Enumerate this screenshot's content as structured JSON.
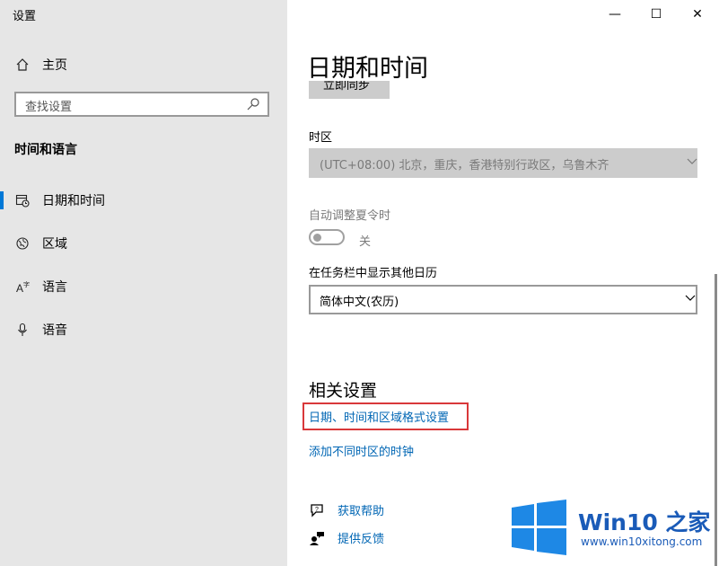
{
  "window": {
    "title": "设置",
    "minimize": "—",
    "maximize": "☐",
    "close": "✕"
  },
  "sidebar": {
    "home_label": "主页",
    "search_placeholder": "查找设置",
    "section_title": "时间和语言",
    "items": [
      {
        "label": "日期和时间",
        "icon": "calendar-clock-icon",
        "active": true
      },
      {
        "label": "区域",
        "icon": "globe-icon",
        "active": false
      },
      {
        "label": "语言",
        "icon": "language-icon",
        "active": false
      },
      {
        "label": "语音",
        "icon": "microphone-icon",
        "active": false
      }
    ]
  },
  "main": {
    "title": "日期和时间",
    "sync_button": "立即同步",
    "timezone_label": "时区",
    "timezone_value": "(UTC+08:00) 北京，重庆，香港特别行政区，乌鲁木齐",
    "dst_label": "自动调整夏令时",
    "dst_state": "关",
    "calendar_label": "在任务栏中显示其他日历",
    "calendar_value": "简体中文(农历)",
    "related_title": "相关设置",
    "related_links": [
      "日期、时间和区域格式设置",
      "添加不同时区的时钟"
    ],
    "help_links": [
      {
        "label": "获取帮助",
        "icon": "help-chat-icon"
      },
      {
        "label": "提供反馈",
        "icon": "feedback-icon"
      }
    ]
  },
  "watermark": {
    "brand": "Win10 之家",
    "url": "www.win10xitong.com"
  },
  "colors": {
    "accent": "#0078d7",
    "link": "#0066b4",
    "highlight": "#d9383a",
    "sidebar_bg": "#e6e6e6"
  }
}
